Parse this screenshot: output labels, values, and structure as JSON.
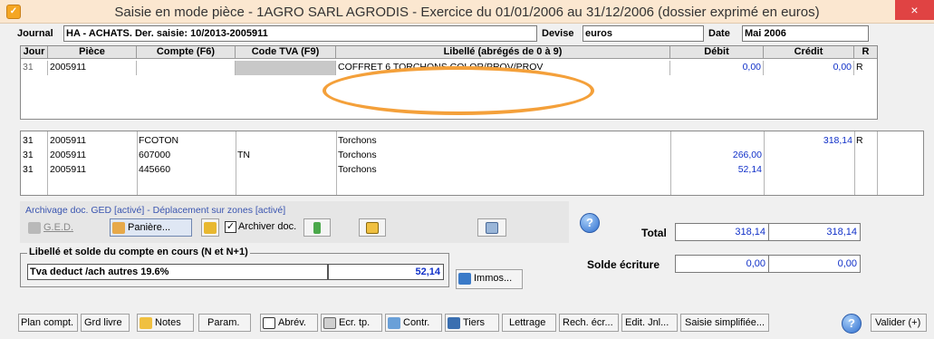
{
  "window": {
    "title": "Saisie en mode pièce - 1AGRO SARL AGRODIS - Exercice du 01/01/2006 au 31/12/2006 (dossier exprimé en euros)",
    "close_glyph": "×"
  },
  "header": {
    "journal_label": "Journal",
    "journal_value": "HA - ACHATS. Der. saisie: 10/2013-2005911",
    "devise_label": "Devise",
    "devise_value": "euros",
    "date_label": "Date",
    "date_value": "Mai 2006"
  },
  "entry_grid": {
    "columns": [
      "Jour",
      "Pièce",
      "Compte (F6)",
      "Code TVA (F9)",
      "Libellé (abrégés de 0 à 9)",
      "Débit",
      "Crédit",
      "R"
    ],
    "row": {
      "jour": "31",
      "piece": "2005911",
      "compte": "",
      "code_tva": "",
      "libelle": "COFFRET 6 TORCHONS COLOR/PROV/PROV",
      "debit": "0,00",
      "credit": "0,00",
      "r": "R"
    }
  },
  "lines": [
    {
      "jour": "31",
      "piece": "2005911",
      "compte": "FCOTON",
      "code_tva": "",
      "libelle": "Torchons",
      "debit": "",
      "credit": "318,14",
      "r": "R"
    },
    {
      "jour": "31",
      "piece": "2005911",
      "compte": "607000",
      "code_tva": "TN",
      "libelle": "Torchons",
      "debit": "266,00",
      "credit": "",
      "r": ""
    },
    {
      "jour": "31",
      "piece": "2005911",
      "compte": "445660",
      "code_tva": "",
      "libelle": "Torchons",
      "debit": "52,14",
      "credit": "",
      "r": ""
    }
  ],
  "ged": {
    "caption": "Archivage doc. GED [activé] - Déplacement sur zones [activé]",
    "ged_label": "G.E.D.",
    "paniere_label": "Panière...",
    "archiver_label": "Archiver doc.",
    "archiver_checked": true
  },
  "account": {
    "group_title": "Libellé et solde du compte en cours (N et N+1)",
    "name": "Tva deduct /ach  autres 19.6%",
    "balance": "52,14",
    "immos_label": "Immos..."
  },
  "totals": {
    "total_label": "Total",
    "total_debit": "318,14",
    "total_credit": "318,14",
    "solde_label": "Solde écriture",
    "solde_debit": "0,00",
    "solde_credit": "0,00"
  },
  "toolbar": {
    "plan": "Plan compt.",
    "grd": "Grd livre",
    "notes": "Notes",
    "param": "Param.",
    "abrev": "Abrév.",
    "ecr": "Ecr. tp.",
    "contr": "Contr.",
    "tiers": "Tiers",
    "lettrage": "Lettrage",
    "rech": "Rech. écr...",
    "edit": "Edit. Jnl...",
    "saisie": "Saisie simplifiée...",
    "valider": "Valider (+)"
  },
  "colors": {
    "titlebar": "#fbe7d0",
    "close": "#e04343",
    "amount_text": "#1030c8",
    "annotation_ring": "#f4a03a"
  }
}
